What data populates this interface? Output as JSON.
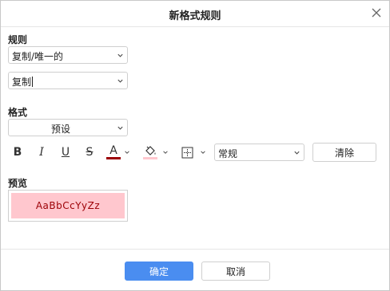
{
  "dialog": {
    "title": "新格式规则"
  },
  "rule": {
    "label": "规则",
    "type_select": "复制/唯一的",
    "value_select": "复制"
  },
  "format": {
    "label": "格式",
    "preset_select": "预设",
    "number_format_select": "常规",
    "clear_button": "清除",
    "font_color": "#9c0006",
    "fill_color": "#ffc7ce"
  },
  "toolbar": {
    "bold": "B",
    "italic": "I",
    "underline": "U",
    "strikethrough": "S",
    "font_color_glyph": "A"
  },
  "preview": {
    "label": "预览",
    "sample_text": "AaBbCcYyZz"
  },
  "footer": {
    "ok_button": "确定",
    "cancel_button": "取消"
  }
}
